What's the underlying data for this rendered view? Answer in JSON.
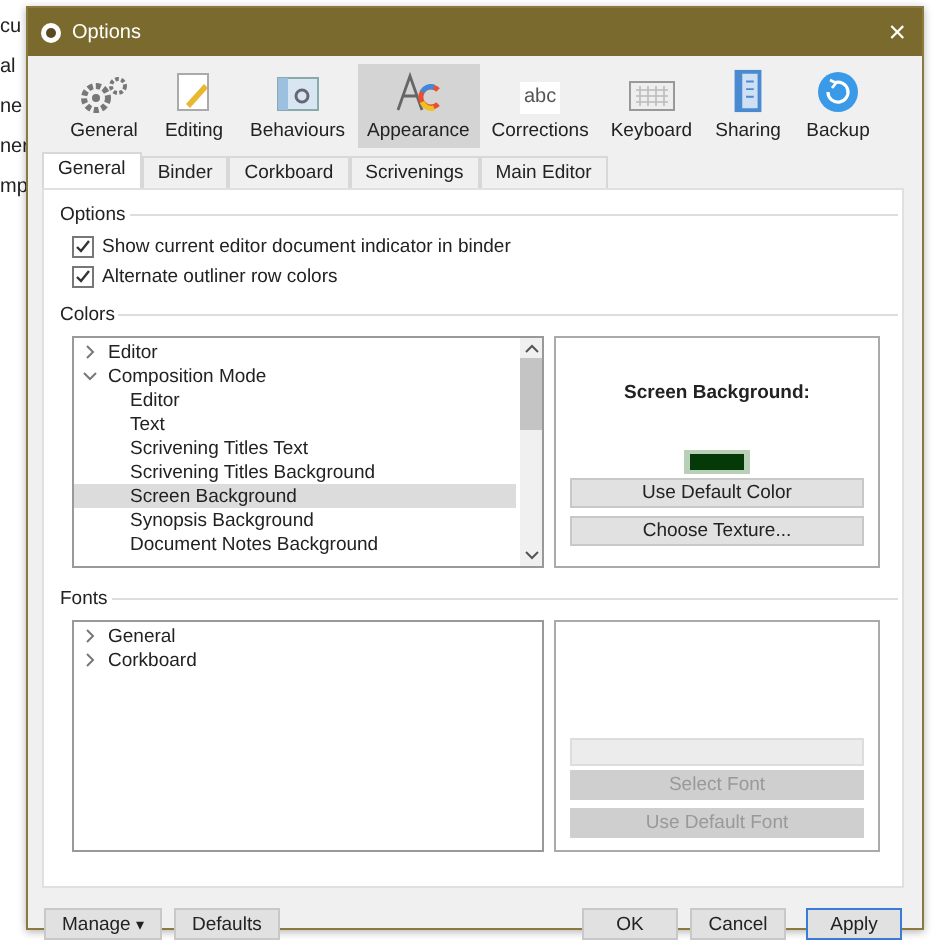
{
  "background_fragments": [
    "cu",
    "al",
    "ne",
    "ner",
    "mp"
  ],
  "window": {
    "title": "Options",
    "close": "×"
  },
  "toolbar": [
    {
      "label": "General",
      "kind": "gears",
      "selected": false
    },
    {
      "label": "Editing",
      "kind": "editing",
      "selected": false
    },
    {
      "label": "Behaviours",
      "kind": "behaviours",
      "selected": false
    },
    {
      "label": "Appearance",
      "kind": "appearance",
      "selected": true
    },
    {
      "label": "Corrections",
      "kind": "corrections",
      "icon_text": "abc",
      "selected": false
    },
    {
      "label": "Keyboard",
      "kind": "keyboard",
      "selected": false
    },
    {
      "label": "Sharing",
      "kind": "sharing",
      "selected": false
    },
    {
      "label": "Backup",
      "kind": "backup",
      "selected": false
    }
  ],
  "tabs": [
    {
      "label": "General",
      "selected": true
    },
    {
      "label": "Binder",
      "selected": false
    },
    {
      "label": "Corkboard",
      "selected": false
    },
    {
      "label": "Scrivenings",
      "selected": false
    },
    {
      "label": "Main Editor",
      "selected": false
    }
  ],
  "options": {
    "label": "Options",
    "checkboxes": [
      {
        "label": "Show current editor document indicator in binder",
        "checked": true
      },
      {
        "label": "Alternate outliner row colors",
        "checked": true
      }
    ]
  },
  "colors": {
    "label": "Colors",
    "tree": [
      {
        "label": "Editor",
        "expanded": false,
        "selected": false
      },
      {
        "label": "Composition Mode",
        "expanded": true,
        "selected": false,
        "children": [
          {
            "label": "Editor",
            "selected": false
          },
          {
            "label": "Text",
            "selected": false
          },
          {
            "label": "Scrivening Titles Text",
            "selected": false
          },
          {
            "label": "Scrivening Titles Background",
            "selected": false
          },
          {
            "label": "Screen Background",
            "selected": true
          },
          {
            "label": "Synopsis Background",
            "selected": false
          },
          {
            "label": "Document Notes Background",
            "selected": false
          }
        ]
      }
    ],
    "detail_title": "Screen Background:",
    "buttons": [
      {
        "label": "Use Default Color",
        "disabled": false
      },
      {
        "label": "Choose Texture...",
        "disabled": false
      }
    ]
  },
  "fonts": {
    "label": "Fonts",
    "tree": [
      {
        "label": "General",
        "expanded": false,
        "selected": false
      },
      {
        "label": "Corkboard",
        "expanded": false,
        "selected": false
      }
    ],
    "field_disabled": true,
    "buttons": [
      {
        "label": "Select Font",
        "disabled": true
      },
      {
        "label": "Use Default Font",
        "disabled": true
      }
    ]
  },
  "footer": {
    "manage": {
      "label": "Manage",
      "caret": "▾"
    },
    "defaults": "Defaults",
    "ok": "OK",
    "cancel": "Cancel",
    "apply": "Apply"
  }
}
